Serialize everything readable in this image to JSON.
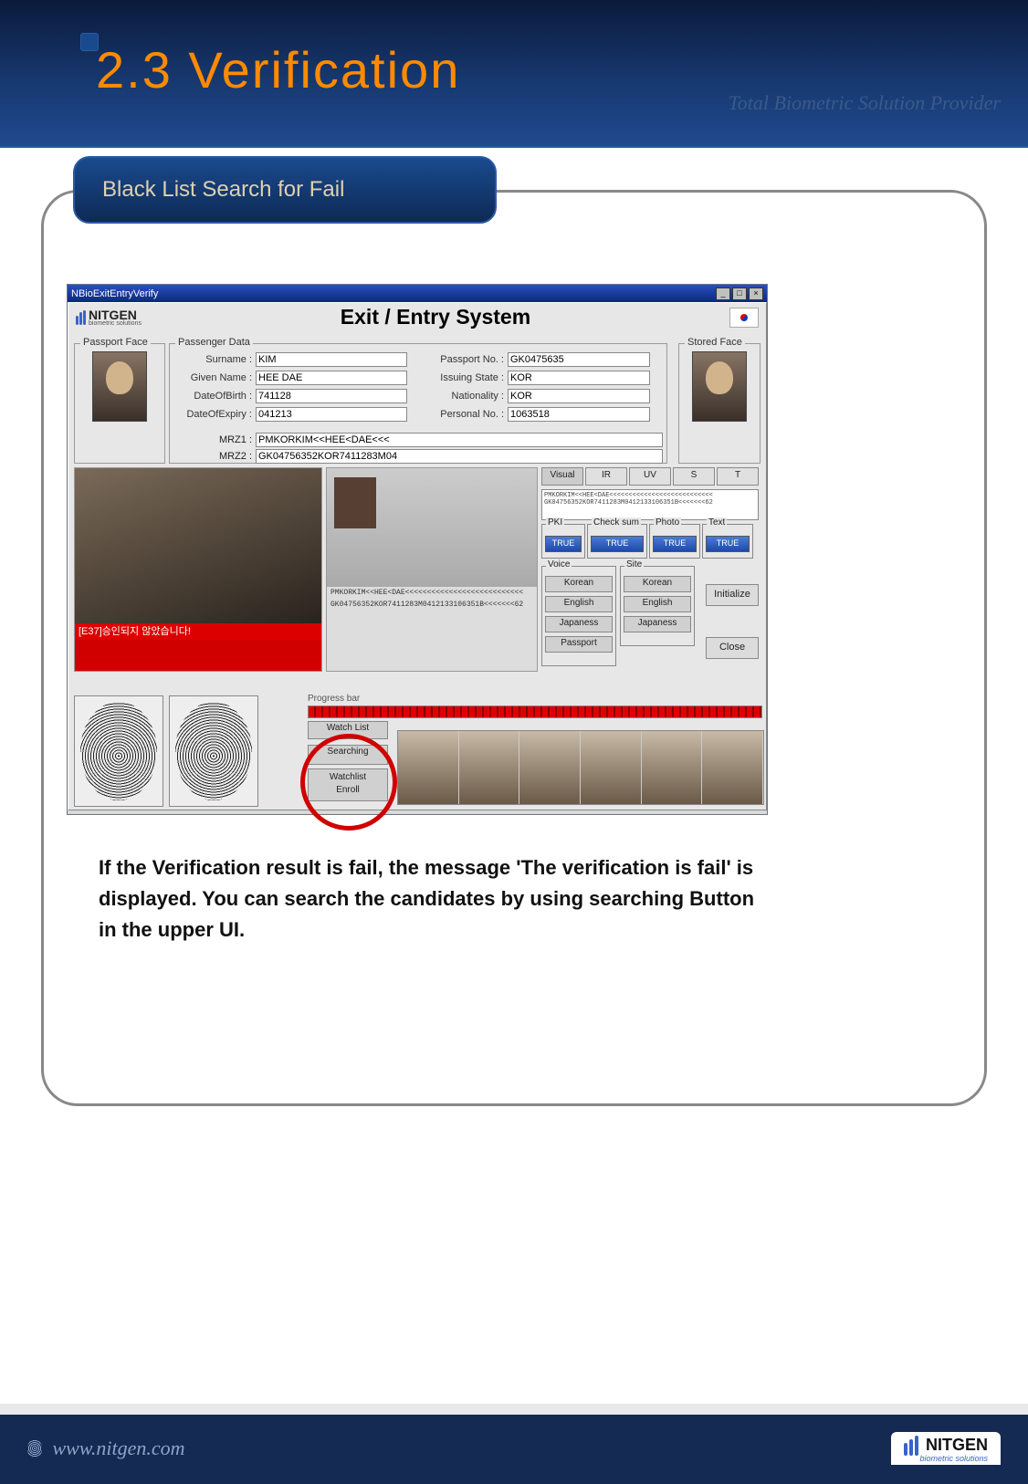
{
  "slide": {
    "title": "2.3 Verification",
    "tagline": "Total Biometric Solution Provider",
    "sub_tab": "Black List Search for Fail",
    "note": "If the Verification result is fail, the message 'The verification is fail' is displayed. You can search the candidates by using searching Button in the upper UI."
  },
  "window_title": "NBioExitEntryVerify",
  "app_title": "Exit / Entry System",
  "brand": {
    "name": "NITGEN",
    "sub": "biometric solutions"
  },
  "legends": {
    "passport_face": "Passport Face",
    "passenger_data": "Passenger Data",
    "stored_face": "Stored Face",
    "progress": "Progress bar"
  },
  "passenger": {
    "labels": {
      "surname": "Surname :",
      "given": "Given Name :",
      "dob": "DateOfBirth :",
      "doe": "DateOfExpiry :",
      "mrz1": "MRZ1 :",
      "ppno": "Passport No. :",
      "state": "Issuing State :",
      "nat": "Nationality :",
      "pno": "Personal No. :",
      "mrz2": "MRZ2 :"
    },
    "surname": "KIM",
    "given": "HEE DAE",
    "dob": "741128",
    "doe": "041213",
    "mrz1": "PMKORKIM<<HEE<DAE<<<",
    "ppno": "GK0475635",
    "state": "KOR",
    "nat": "KOR",
    "pno": "1063518",
    "mrz2": "GK04756352KOR7411283M04"
  },
  "error_msg": "[E37]승인되지 않았습니다!",
  "doc_mrz1": "PMKORKIM<<HEE<DAE<<<<<<<<<<<<<<<<<<<<<<<<<<<",
  "doc_mrz2": "GK04756352KOR7411283M0412133106351B<<<<<<<62",
  "tabs": {
    "visual": "Visual",
    "ir": "IR",
    "uv": "UV",
    "s": "S",
    "t": "T"
  },
  "mrz_preview": "PMKORKIM<<HEE<DAE<<<<<<<<<<<<<<<<<<<<<<<<<<<\nGK04756352KOR7411283M0412133106351B<<<<<<<62",
  "checks": {
    "pki": {
      "label": "PKI",
      "value": "TRUE"
    },
    "checksum": {
      "label": "Check sum",
      "value": "TRUE"
    },
    "photo": {
      "label": "Photo",
      "value": "TRUE"
    },
    "text": {
      "label": "Text",
      "value": "TRUE"
    }
  },
  "voice": {
    "legend": "Voice",
    "korean": "Korean",
    "english": "English",
    "japanese": "Japaness",
    "passport": "Passport"
  },
  "site": {
    "legend": "Site",
    "korean": "Korean",
    "english": "English",
    "japanese": "Japaness"
  },
  "actions": {
    "initialize": "Initialize",
    "close": "Close"
  },
  "watchlist": {
    "label": "Watch List",
    "searching": "Searching",
    "enroll": "Watchlist\nEnroll"
  },
  "footer": {
    "url": "www.nitgen.com",
    "brand": "NITGEN",
    "sub": "biometric solutions"
  }
}
